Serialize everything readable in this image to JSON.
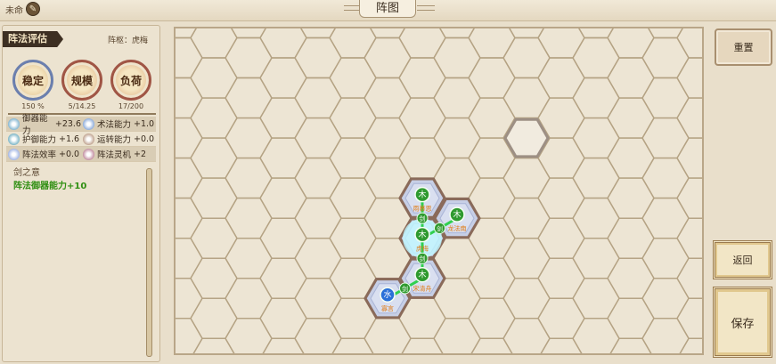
{
  "topbar": {
    "unnamed_label": "未命",
    "title": "阵图"
  },
  "left_panel": {
    "eval_tag": "阵法评估",
    "pivot": "阵枢：虎梅",
    "seals": [
      {
        "glyph": "稳定",
        "value": "150 %"
      },
      {
        "glyph": "规模",
        "value": "5/14.25"
      },
      {
        "glyph": "负荷",
        "value": "17/200"
      }
    ],
    "stats": [
      {
        "label": "御器能力",
        "value": "+23.6"
      },
      {
        "label": "术法能力",
        "value": "+1.0"
      },
      {
        "label": "护御能力",
        "value": "+1.6"
      },
      {
        "label": "运转能力",
        "value": "+0.0"
      },
      {
        "label": "阵法效率",
        "value": "+0.0"
      },
      {
        "label": "阵法灵机",
        "value": "+2"
      }
    ],
    "mind_title": "剑之意",
    "mind_effect": "阵法御器能力+10"
  },
  "board": {
    "nodes": [
      {
        "element": "木",
        "name": "雨慕恩"
      },
      {
        "element": "木",
        "name": "龙法南"
      },
      {
        "element": "木",
        "name": "虎梅"
      },
      {
        "element": "木",
        "name": "宋清舟"
      },
      {
        "element": "水",
        "name": "寡言"
      }
    ],
    "link_glyph": "剑",
    "accent": {
      "link": "#30d050",
      "wood": "#2f9a2f",
      "water": "#2a70d8",
      "tile": "#c7cfe6",
      "tile_rim": "#8a6a5a"
    }
  },
  "buttons": {
    "reset": "重置",
    "back": "返回",
    "save": "保存"
  }
}
